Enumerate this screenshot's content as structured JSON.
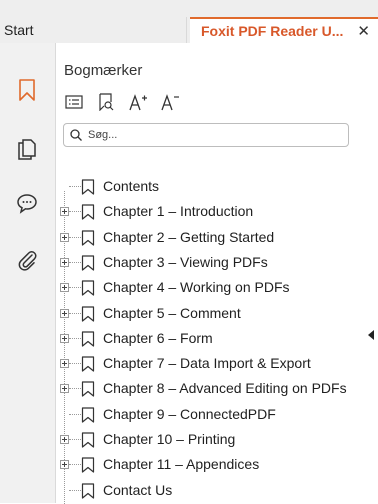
{
  "tabs": {
    "start_label": "Start",
    "doc_label": "Foxit PDF Reader U...",
    "close_glyph": "✕"
  },
  "rail": {
    "items": [
      {
        "icon": "bookmark-icon",
        "active": true
      },
      {
        "icon": "pages-icon",
        "active": false
      },
      {
        "icon": "comment-icon",
        "active": false
      },
      {
        "icon": "attachment-icon",
        "active": false
      }
    ],
    "accent_color": "#e06a2c"
  },
  "panel": {
    "title": "Bogmærker",
    "toolbar": [
      "options-icon",
      "add-bookmark-icon",
      "increase-font-icon",
      "decrease-font-icon"
    ],
    "search_placeholder": "Søg..."
  },
  "bookmarks": [
    {
      "label": "Contents",
      "expandable": false
    },
    {
      "label": "Chapter 1 – Introduction",
      "expandable": true
    },
    {
      "label": "Chapter 2 – Getting Started",
      "expandable": true
    },
    {
      "label": "Chapter 3 – Viewing PDFs",
      "expandable": true
    },
    {
      "label": "Chapter 4 – Working on PDFs",
      "expandable": true
    },
    {
      "label": "Chapter 5 – Comment",
      "expandable": true
    },
    {
      "label": "Chapter 6 – Form",
      "expandable": true
    },
    {
      "label": "Chapter 7 – Data Import & Export",
      "expandable": true
    },
    {
      "label": "Chapter 8 – Advanced Editing on PDFs",
      "expandable": true
    },
    {
      "label": "Chapter 9 – ConnectedPDF",
      "expandable": false
    },
    {
      "label": "Chapter 10 – Printing",
      "expandable": true
    },
    {
      "label": "Chapter 11 – Appendices",
      "expandable": true
    },
    {
      "label": "Contact Us",
      "expandable": false
    }
  ]
}
